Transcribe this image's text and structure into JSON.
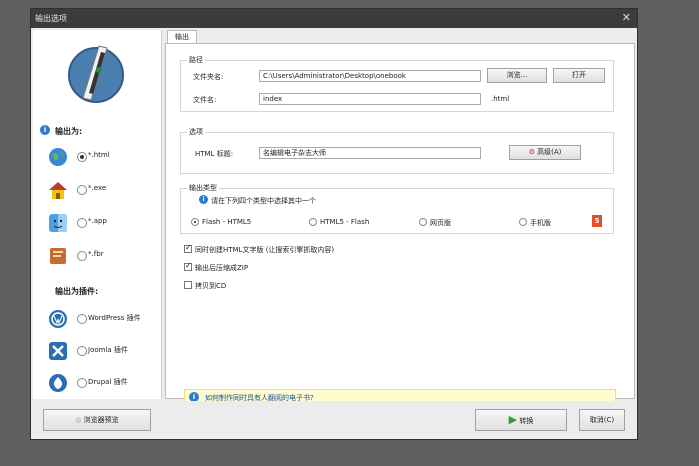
{
  "window": {
    "title": "输出选项",
    "close_glyph": "✕"
  },
  "left": {
    "output_as_label": "输出为:",
    "formats": [
      {
        "label": "*.html",
        "selected": true,
        "icon": "globe-icon"
      },
      {
        "label": "*.exe",
        "selected": false,
        "icon": "house-icon"
      },
      {
        "label": "*.app",
        "selected": false,
        "icon": "mac-finder-icon"
      },
      {
        "label": "*.fbr",
        "selected": false,
        "icon": "book-icon"
      }
    ],
    "plugin_label": "输出为插件:",
    "plugins": [
      {
        "label": "WordPress 插件",
        "selected": false,
        "icon": "wordpress-icon"
      },
      {
        "label": "Joomla 插件",
        "selected": false,
        "icon": "joomla-icon"
      },
      {
        "label": "Drupal 插件",
        "selected": false,
        "icon": "drupal-icon"
      }
    ]
  },
  "tab": {
    "label": "输出"
  },
  "path": {
    "group_label": "路径",
    "folder_label": "文件夹名:",
    "folder_value": "C:\\Users\\Administrator\\Desktop\\onebook",
    "browse_label": "浏览...",
    "open_label": "打开",
    "file_label": "文件名:",
    "file_value": "index",
    "ext": ".html"
  },
  "options": {
    "group_label": "选项",
    "title_label": "HTML 标题:",
    "title_value": "名编辑电子杂志大师",
    "advanced_label": "高级(A)"
  },
  "output_type": {
    "group_label": "输出类型",
    "hint": "请在下列四个类型中选择其中一个",
    "choices": [
      {
        "label": "Flash - HTML5",
        "selected": true
      },
      {
        "label": "HTML5 - Flash",
        "selected": false
      },
      {
        "label": "网页版",
        "selected": false
      },
      {
        "label": "手机版",
        "selected": false
      }
    ],
    "html5_badge": "5"
  },
  "checkboxes": [
    {
      "label": "同时创建HTML文字版 (让搜索引擎抓取内容)",
      "checked": true
    },
    {
      "label": "输出后压缩成ZIP",
      "checked": true
    },
    {
      "label": "拷贝到CD",
      "checked": false
    }
  ],
  "help": {
    "text": "如何制作同时具有人翻阅的电子书?",
    "icon": "i"
  },
  "bottom": {
    "preview_label": "浏览器预览",
    "convert_label": "转换",
    "cancel_label": "取消(C)"
  },
  "colors": {
    "accent": "#2b7bd0",
    "hint_bg": "#fffbcc",
    "title_bg": "#3c3c3c"
  }
}
